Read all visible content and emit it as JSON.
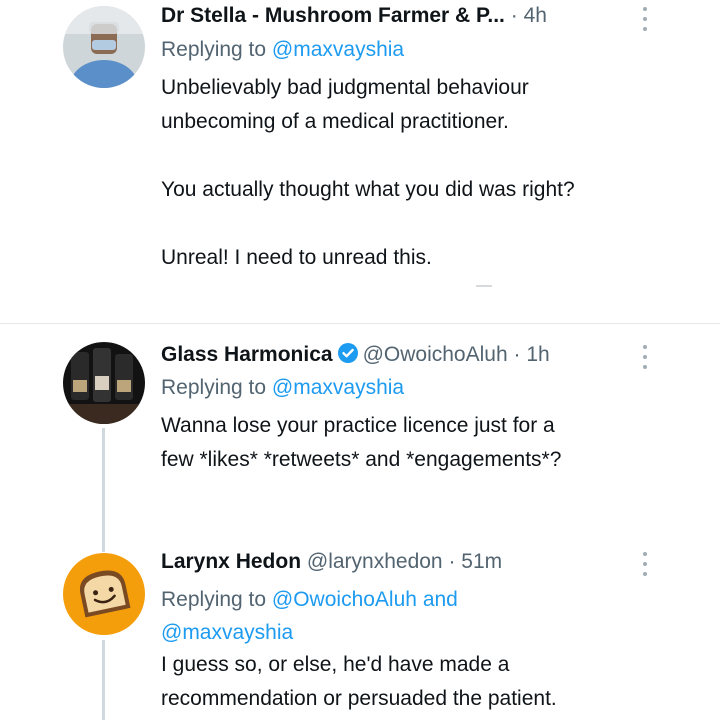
{
  "tweets": [
    {
      "name": "Dr Stella - Mushroom Farmer & P...",
      "handle": "",
      "dot": "·",
      "time": "4h",
      "replying_prefix": "Replying to",
      "replying_to": "@maxvayshia",
      "lines": [
        "Unbelievably bad judgmental behaviour",
        "unbecoming of a medical practitioner.",
        "",
        "You actually thought what you did was right?",
        "",
        "Unreal! I need to unread this."
      ]
    },
    {
      "name": "Glass Harmonica",
      "verified": true,
      "handle": "@OwoichoAluh",
      "dot": "·",
      "time": "1h",
      "replying_prefix": "Replying to",
      "replying_to": "@maxvayshia",
      "lines": [
        "Wanna lose your practice licence just for a",
        "few *likes* *retweets* and *engagements*?"
      ]
    },
    {
      "name": "Larynx Hedon",
      "handle": "@larynxhedon",
      "dot": "·",
      "time": "51m",
      "replying_prefix": "Replying to",
      "replying_to_1": "@OwoichoAluh",
      "replying_and": "and",
      "replying_to_2": "@maxvayshia",
      "lines": [
        "I guess so, or else, he'd have made a",
        "recommendation or persuaded the patient."
      ]
    }
  ],
  "icons": {
    "verified_badge": "verified-check-icon",
    "more": "more-options-icon"
  },
  "colors": {
    "link": "#1d9bf0",
    "secondary": "#536471",
    "verified": "#1d9bf0",
    "avatar3": "#f59e0b"
  }
}
